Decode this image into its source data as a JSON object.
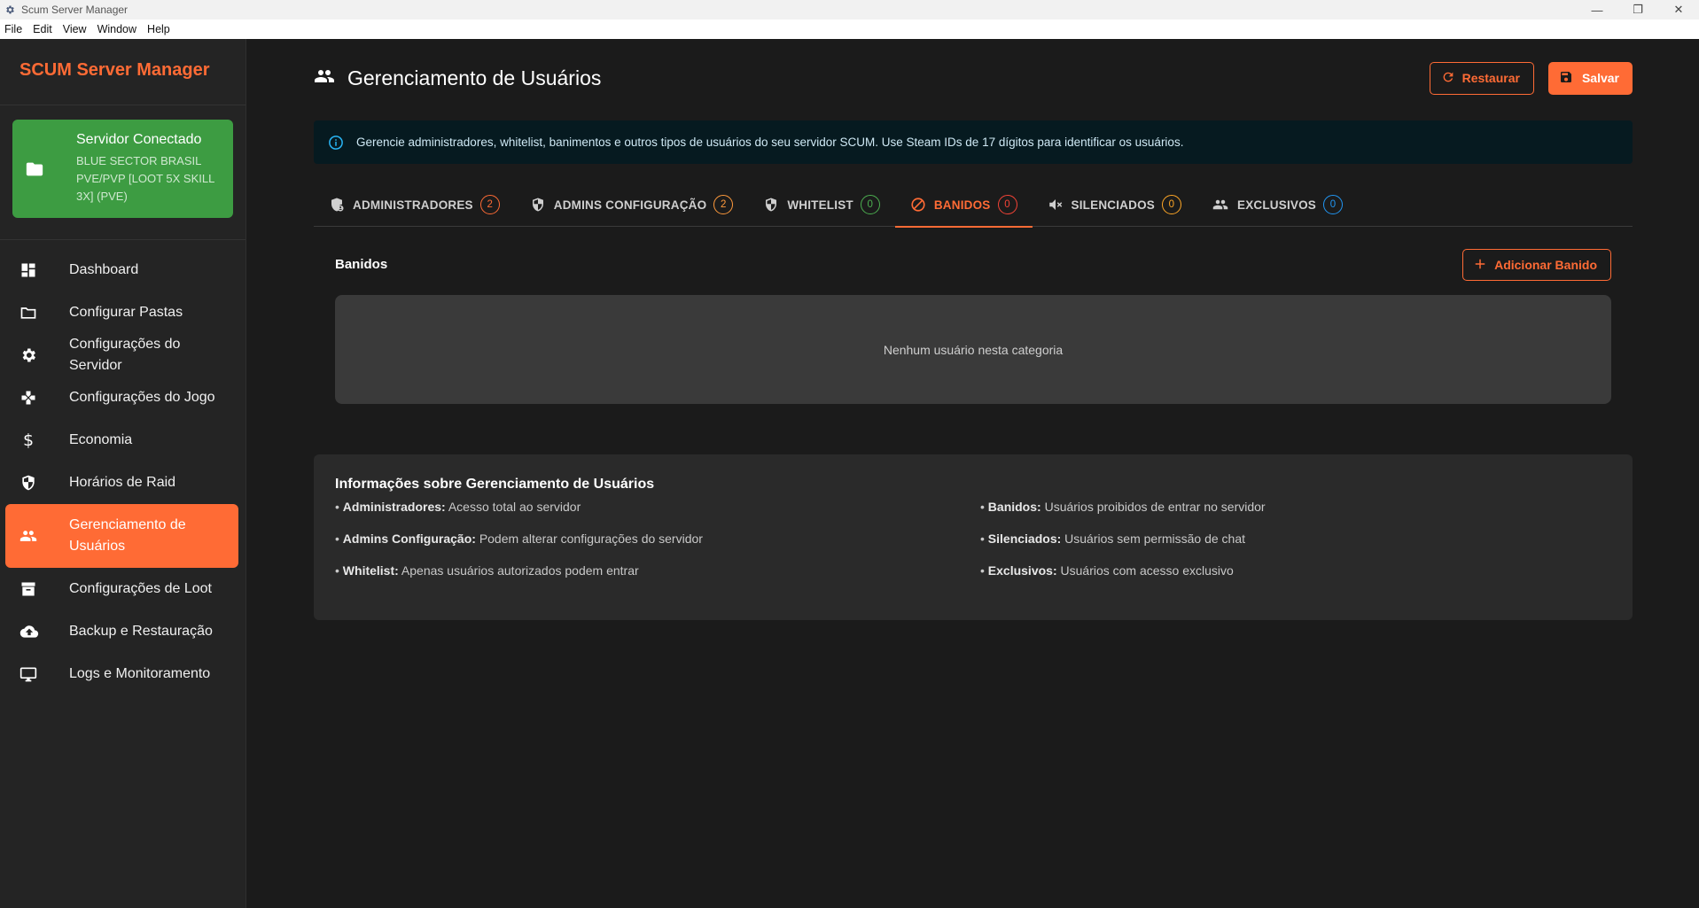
{
  "window": {
    "title": "Scum Server Manager",
    "controls": {
      "minimize": "—",
      "maximize": "❐",
      "close": "✕"
    }
  },
  "menu": [
    "File",
    "Edit",
    "View",
    "Window",
    "Help"
  ],
  "sidebar": {
    "brand": "SCUM Server Manager",
    "server": {
      "status": "Servidor Conectado",
      "name": "BLUE SECTOR BRASIL PVE/PVP [LOOT 5X SKILL 3X] (PVE)"
    },
    "items": [
      {
        "label": "Dashboard",
        "icon": "dashboard-icon"
      },
      {
        "label": "Configurar Pastas",
        "icon": "folder-icon"
      },
      {
        "label": "Configurações do Servidor",
        "icon": "gear-icon"
      },
      {
        "label": "Configurações do Jogo",
        "icon": "gamepad-icon"
      },
      {
        "label": "Economia",
        "icon": "dollar-icon"
      },
      {
        "label": "Horários de Raid",
        "icon": "shield-icon"
      },
      {
        "label": "Gerenciamento de Usuários",
        "icon": "people-icon",
        "active": true
      },
      {
        "label": "Configurações de Loot",
        "icon": "archive-icon"
      },
      {
        "label": "Backup e Restauração",
        "icon": "cloud-upload-icon"
      },
      {
        "label": "Logs e Monitoramento",
        "icon": "monitor-icon"
      }
    ]
  },
  "header": {
    "title": "Gerenciamento de Usuários",
    "restore_label": "Restaurar",
    "save_label": "Salvar"
  },
  "alert": {
    "text": "Gerencie administradores, whitelist, banimentos e outros tipos de usuários do seu servidor SCUM. Use Steam IDs de 17 dígitos para identificar os usuários."
  },
  "tabs": [
    {
      "label": "ADMINISTRADORES",
      "count": "2",
      "color": "#ff6b35",
      "icon": "admin-shield-icon"
    },
    {
      "label": "ADMINS CONFIGURAÇÃO",
      "count": "2",
      "color": "#ff9a3c",
      "icon": "shield-half-icon"
    },
    {
      "label": "WHITELIST",
      "count": "0",
      "color": "#4caf50",
      "icon": "shield-check-icon"
    },
    {
      "label": "BANIDOS",
      "count": "0",
      "color": "#f44336",
      "icon": "ban-icon",
      "active": true
    },
    {
      "label": "SILENCIADOS",
      "count": "0",
      "color": "#ffa726",
      "icon": "mute-icon"
    },
    {
      "label": "EXCLUSIVOS",
      "count": "0",
      "color": "#2196f3",
      "icon": "people-icon"
    }
  ],
  "section": {
    "title": "Banidos",
    "add_label": "Adicionar Banido",
    "empty_text": "Nenhum usuário nesta categoria"
  },
  "info": {
    "title": "Informações sobre Gerenciamento de Usuários",
    "items": [
      {
        "term": "Administradores:",
        "desc": "Acesso total ao servidor"
      },
      {
        "term": "Banidos:",
        "desc": "Usuários proibidos de entrar no servidor"
      },
      {
        "term": "Admins Configuração:",
        "desc": "Podem alterar configurações do servidor"
      },
      {
        "term": "Silenciados:",
        "desc": "Usuários sem permissão de chat"
      },
      {
        "term": "Whitelist:",
        "desc": "Apenas usuários autorizados podem entrar"
      },
      {
        "term": "Exclusivos:",
        "desc": "Usuários com acesso exclusivo"
      }
    ],
    "bullet": "•"
  },
  "colors": {
    "accent": "#ff6b35",
    "server_card": "#3d9c42",
    "info": "#29b6f6"
  }
}
